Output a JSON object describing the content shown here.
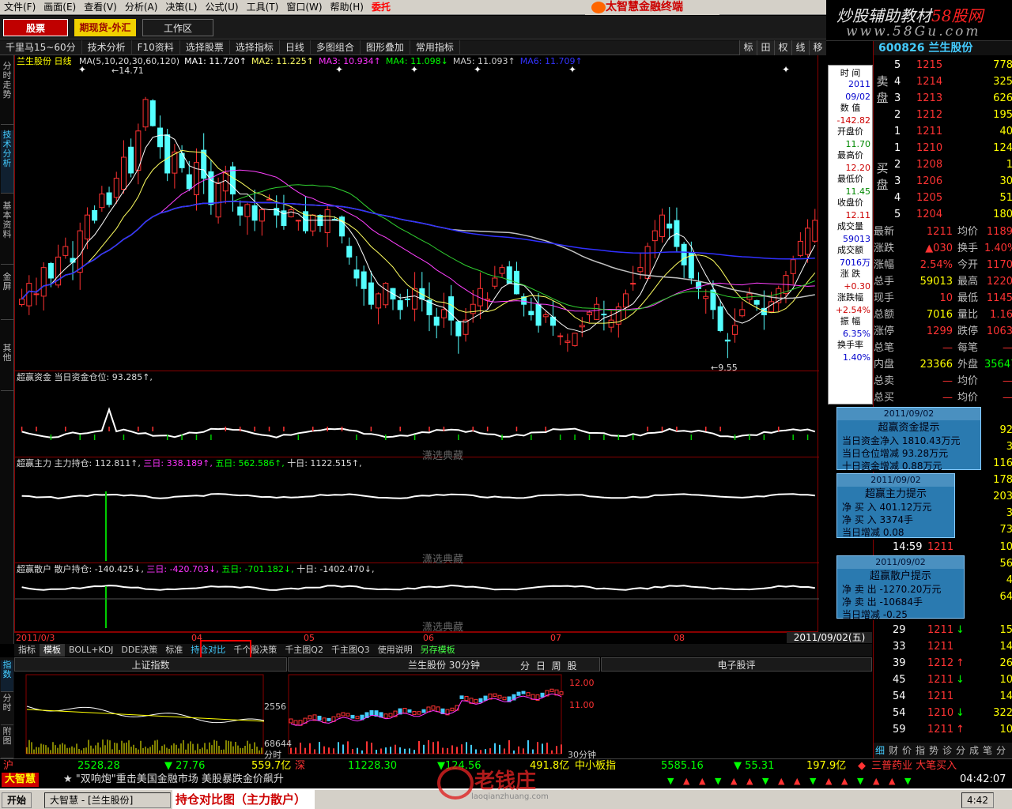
{
  "menu": [
    "文件(F)",
    "画面(E)",
    "查看(V)",
    "分析(A)",
    "决策(L)",
    "公式(U)",
    "工具(T)",
    "窗口(W)",
    "帮助(H)",
    "委托"
  ],
  "brand": "太智慧金融终端",
  "watermark": {
    "line1_a": "炒股辅助教材",
    "line1_b": "58股网",
    "line2": "www.58Gu.com"
  },
  "toolbar1": {
    "stock": "股票",
    "futures": "期现货-外汇",
    "workspace": "工作区"
  },
  "toolbar2": [
    "千里马15~60分",
    "技术分析",
    "F10资料",
    "选择股票",
    "选择指标",
    "日线",
    "多图组合",
    "图形叠加",
    "常用指标"
  ],
  "right_toolbar": [
    "标",
    "田",
    "权",
    "线",
    "移"
  ],
  "left_tabs": [
    "分时走势",
    "技术分析",
    "基本资料",
    "金屏",
    "其他"
  ],
  "main": {
    "title": "兰生股份 日线",
    "ma_legend": [
      {
        "t": "MA(5,10,20,30,60,120)",
        "c": "#ddd"
      },
      {
        "t": "MA1: 11.720↑",
        "c": "#fff"
      },
      {
        "t": "MA2: 11.225↑",
        "c": "#ff6"
      },
      {
        "t": "MA3: 10.934↑",
        "c": "#f3f"
      },
      {
        "t": "MA4: 11.098↓",
        "c": "#0f0"
      },
      {
        "t": "MA5: 11.093↑",
        "c": "#ccc"
      },
      {
        "t": "MA6: 11.709↑",
        "c": "#33f"
      }
    ],
    "high_label": "←14.71",
    "low_label": "←9.55",
    "p1": "超赢资金  当日资金仓位: 93.285↑,",
    "p2_a": "超赢主力  主力持仓: 112.811↑,",
    "p2_b": "三日: 338.189↑,",
    "p2_c": "五日: 562.586↑,",
    "p2_d": "十日: 1122.515↑,",
    "p3_a": "超赢散户  散户持仓: -140.425↓,",
    "p3_b": "三日: -420.703↓,",
    "p3_c": "五日: -701.182↓,",
    "p3_d": "十日: -1402.470↓,",
    "footer_wm": "潇选典藏"
  },
  "date_axis": {
    "labels": [
      "2011/0/3",
      "04",
      "05",
      "06",
      "07",
      "08"
    ],
    "end": "2011/09/02(五)"
  },
  "bottom_tabs": [
    "指标",
    "模板",
    "BOLL+KDJ",
    "DDE决策",
    "标准",
    "持仓对比",
    "千个股决策",
    "千主图Q2",
    "千主图Q3",
    "使用说明",
    "另存模板"
  ],
  "info_panel": [
    {
      "t": "时  间",
      "k": "l"
    },
    {
      "t": "2011",
      "k": "vb"
    },
    {
      "t": "09/02",
      "k": "vb"
    },
    {
      "t": "数  值",
      "k": "l"
    },
    {
      "t": "-142.82",
      "k": "v"
    },
    {
      "t": "开盘价",
      "k": "l"
    },
    {
      "t": "11.70",
      "k": "vg"
    },
    {
      "t": "最高价",
      "k": "l"
    },
    {
      "t": "12.20",
      "k": "v"
    },
    {
      "t": "最低价",
      "k": "l"
    },
    {
      "t": "11.45",
      "k": "vg"
    },
    {
      "t": "收盘价",
      "k": "l"
    },
    {
      "t": "12.11",
      "k": "v"
    },
    {
      "t": "成交量",
      "k": "l"
    },
    {
      "t": "59013",
      "k": "vb"
    },
    {
      "t": "成交额",
      "k": "l"
    },
    {
      "t": "7016万",
      "k": "vb"
    },
    {
      "t": "涨  跌",
      "k": "l"
    },
    {
      "t": "+0.30",
      "k": "v"
    },
    {
      "t": "涨跌幅",
      "k": "l"
    },
    {
      "t": "+2.54%",
      "k": "v"
    },
    {
      "t": "振  幅",
      "k": "l"
    },
    {
      "t": "6.35%",
      "k": "vb"
    },
    {
      "t": "换手率",
      "k": "l"
    },
    {
      "t": "1.40%",
      "k": "vb"
    }
  ],
  "quote": {
    "head": "600826 兰生股份",
    "sell": [
      [
        "5",
        "1215",
        "778"
      ],
      [
        "4",
        "1214",
        "325"
      ],
      [
        "3",
        "1213",
        "626"
      ],
      [
        "2",
        "1212",
        "195"
      ],
      [
        "1",
        "1211",
        "40"
      ]
    ],
    "buy": [
      [
        "1",
        "1210",
        "124"
      ],
      [
        "2",
        "1208",
        "1"
      ],
      [
        "3",
        "1206",
        "30"
      ],
      [
        "4",
        "1205",
        "51"
      ],
      [
        "5",
        "1204",
        "180"
      ]
    ],
    "sell_word": "卖 盘",
    "buy_word": "买 盘",
    "stats": [
      [
        "最新",
        "1211",
        "均价",
        "1189"
      ],
      [
        "涨跌",
        "▲030",
        "换手",
        "1.40%"
      ],
      [
        "涨幅",
        "2.54%",
        "今开",
        "1170"
      ],
      [
        "总手",
        "59013",
        "最高",
        "1220"
      ],
      [
        "现手",
        "10",
        "最低",
        "1145"
      ],
      [
        "总额",
        "7016",
        "量比",
        "1.16"
      ],
      [
        "涨停",
        "1299",
        "跌停",
        "1063"
      ],
      [
        "总笔",
        "—",
        "每笔",
        "—"
      ],
      [
        "内盘",
        "23366",
        "外盘",
        "35647"
      ],
      [
        "总卖",
        "—",
        "均价",
        "—"
      ],
      [
        "总买",
        "—",
        "均价",
        "—"
      ]
    ],
    "vol_tail": [
      [
        "92",
        ""
      ],
      [
        "3",
        ""
      ],
      [
        "116",
        ""
      ],
      [
        "178",
        ""
      ],
      [
        "203",
        ""
      ],
      [
        "3",
        ""
      ],
      [
        "73",
        ""
      ]
    ],
    "ticks": [
      [
        "14:59",
        "1211",
        "",
        "10"
      ],
      [
        "",
        "",
        "",
        "56"
      ],
      [
        "",
        "",
        "",
        "4"
      ],
      [
        "",
        "",
        "",
        "64"
      ],
      [
        "",
        "",
        "",
        ""
      ],
      [
        "29",
        "1211",
        "↓",
        "15"
      ],
      [
        "33",
        "1211",
        "",
        "14"
      ],
      [
        "39",
        "1212",
        "↑",
        "26"
      ],
      [
        "45",
        "1211",
        "↓",
        "10"
      ],
      [
        "54",
        "1211",
        "",
        "14"
      ],
      [
        "54",
        "1210",
        "↓",
        "322"
      ],
      [
        "59",
        "1211",
        "↑",
        "10"
      ]
    ],
    "bottom_tabs": [
      "细",
      "财",
      "价",
      "指",
      "势",
      "诊",
      "分",
      "成",
      "笔",
      "分"
    ]
  },
  "tips": [
    {
      "date": "2011/09/02",
      "title": "超赢资金提示",
      "lines": [
        "当日资金净入  1810.43万元",
        "当日仓位增减  93.28万元",
        "十日资金增减  0.88万元"
      ]
    },
    {
      "date": "2011/09/02",
      "title": "超赢主力提示",
      "lines": [
        "净  买  入  401.12万元",
        "净  买  入  3374手",
        "当日增减  0.08"
      ]
    },
    {
      "date": "2011/09/02",
      "title": "超赢散户提示",
      "lines": [
        "净  卖  出  -1270.20万元",
        "净  卖  出  -10684手",
        "当日增减  -0.25"
      ]
    }
  ],
  "bottom_panes": {
    "left_title": "上证指数",
    "mid_title": "兰生股份 30分钟",
    "mid_tabs": "分 日 周 股",
    "right_title": "电子股评",
    "left_vtabs": [
      "指数",
      "分时",
      "附图"
    ],
    "lvals": [
      "2556",
      "68644"
    ],
    "mvals": [
      "12.00",
      "11.00"
    ],
    "ltime": "分时",
    "mtime": "30分钟"
  },
  "status": {
    "sh": "沪",
    "sh_val": "2528.28",
    "sh_chg": "▼ 27.76",
    "sh_amt": "559.7亿",
    "sz": "深",
    "sz_val": "11228.30",
    "sz_chg": "▼124.56",
    "sz_amt": "491.8亿",
    "mid": "中小板指",
    "mid_val": "5585.16",
    "mid_chg": "▼ 55.31",
    "mid_amt": "197.9亿",
    "news2": "三普药业 大笔买入"
  },
  "status2": {
    "logo": "大智慧",
    "news": "★ \"双响炮\"重击美国金融市场 美股暴跌金价飙升",
    "time": "04:42:07"
  },
  "taskbar": {
    "start": "开始",
    "task1": "大智慧 - [兰生股份]",
    "caption": "持仓对比图（主力散户）",
    "clock": "4:42"
  },
  "site_wm": {
    "text": "老钱庄",
    "url": "laoqianzhuang.com"
  },
  "chart_data": {
    "type": "candlestick",
    "title": "兰生股份 日线",
    "ylim": [
      9.3,
      15.0
    ],
    "high": 14.71,
    "low": 9.55,
    "closes": [
      10.6,
      10.9,
      10.7,
      11.2,
      11.0,
      11.4,
      11.6,
      11.3,
      11.9,
      12.2,
      12.1,
      12.6,
      12.4,
      12.9,
      13.3,
      13.0,
      13.8,
      14.4,
      13.9,
      13.5,
      13.0,
      13.4,
      13.1,
      12.7,
      13.2,
      12.9,
      12.4,
      12.8,
      13.0,
      12.6,
      12.2,
      12.4,
      12.1,
      12.3,
      12.5,
      12.2,
      12.0,
      12.3,
      12.1,
      11.9,
      12.2,
      12.0,
      12.3,
      12.1,
      11.8,
      11.4,
      11.0,
      10.8,
      10.5,
      10.7,
      10.9,
      10.6,
      10.4,
      10.6,
      10.8,
      10.6,
      10.3,
      10.1,
      10.4,
      10.2,
      9.9,
      10.2,
      10.5,
      10.8,
      10.6,
      11.0,
      11.2,
      10.9,
      10.7,
      10.5,
      10.3,
      10.1,
      10.3,
      10.1,
      9.9,
      9.8,
      9.95,
      10.1,
      10.35,
      10.5,
      10.3,
      10.2,
      10.45,
      10.7,
      10.9,
      11.2,
      11.6,
      11.9,
      12.2,
      11.95,
      11.6,
      11.25,
      11.0,
      10.8,
      10.65,
      10.4,
      10.0,
      9.8,
      10.1,
      10.4,
      10.7,
      10.5,
      10.3,
      10.55,
      10.8,
      11.05,
      11.35,
      11.7,
      11.95,
      12.1
    ],
    "bottom_axis": "dates",
    "indicators": [
      "超赢资金",
      "超赢主力",
      "超赢散户"
    ]
  }
}
